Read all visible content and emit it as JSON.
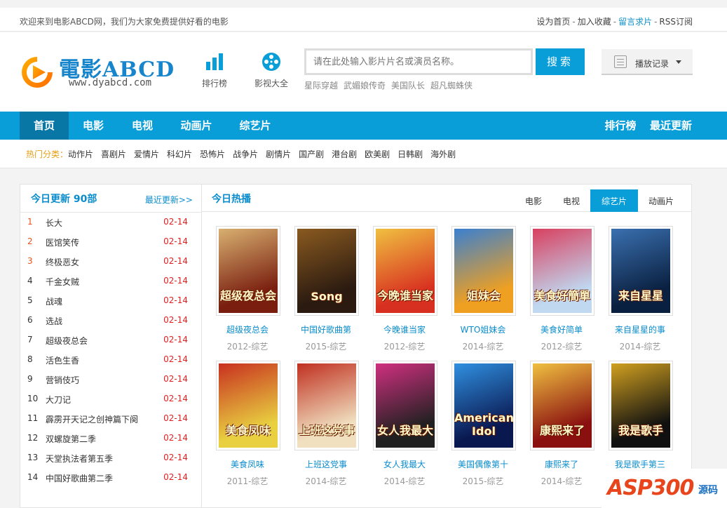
{
  "topbar": {
    "welcome": "欢迎来到电影ABCD网，我们为大家免费提供好看的电影",
    "links": [
      "设为首页",
      "加入收藏",
      "留言求片",
      "RSS订阅"
    ]
  },
  "logo": {
    "title": "電影ABCD",
    "domain": "www.dyabcd.com"
  },
  "header_icons": [
    {
      "label": "排行榜",
      "icon": "bar-chart-icon"
    },
    {
      "label": "影视大全",
      "icon": "film-reel-icon"
    }
  ],
  "search": {
    "placeholder": "请在此处输入影片片名或演员名称。",
    "button": "搜索",
    "hot_words": [
      "星际穿越",
      "武媚娘传奇",
      "美国队长",
      "超凡蜘蛛侠"
    ]
  },
  "history": {
    "label": "播放记录"
  },
  "nav": {
    "left": [
      "首页",
      "电影",
      "电视",
      "动画片",
      "综艺片"
    ],
    "right": [
      "排行榜",
      "最近更新"
    ]
  },
  "categories": {
    "label": "热门分类：",
    "items": [
      "动作片",
      "喜剧片",
      "爱情片",
      "科幻片",
      "恐怖片",
      "战争片",
      "剧情片",
      "国产剧",
      "港台剧",
      "欧美剧",
      "日韩剧",
      "海外剧"
    ]
  },
  "today_update": {
    "title": "今日更新 90部",
    "more": "最近更新>>",
    "items": [
      {
        "rank": "1",
        "name": "长大",
        "date": "02-14"
      },
      {
        "rank": "2",
        "name": "医馆笑传",
        "date": "02-14"
      },
      {
        "rank": "3",
        "name": "终极恶女",
        "date": "02-14"
      },
      {
        "rank": "4",
        "name": "千金女贼",
        "date": "02-14"
      },
      {
        "rank": "5",
        "name": "战魂",
        "date": "02-14"
      },
      {
        "rank": "6",
        "name": "选战",
        "date": "02-14"
      },
      {
        "rank": "7",
        "name": "超级夜总会",
        "date": "02-14"
      },
      {
        "rank": "8",
        "name": "活色生香",
        "date": "02-14"
      },
      {
        "rank": "9",
        "name": "营销伎巧",
        "date": "02-14"
      },
      {
        "rank": "10",
        "name": "大刀记",
        "date": "02-14"
      },
      {
        "rank": "11",
        "name": "霹雳开天记之创神篇下阕",
        "date": "02-14"
      },
      {
        "rank": "12",
        "name": "双螺旋第二季",
        "date": "02-14"
      },
      {
        "rank": "13",
        "name": "天堂执法者第五季",
        "date": "02-14"
      },
      {
        "rank": "14",
        "name": "中国好歌曲第二季",
        "date": "02-14"
      }
    ]
  },
  "hot_today": {
    "title": "今日热播",
    "tabs": [
      "电影",
      "电视",
      "综艺片",
      "动画片"
    ],
    "active_tab": "综艺片",
    "items": [
      {
        "title": "超级夜总会",
        "meta": "2012-综艺",
        "art": "超级夜总会",
        "bg": "#7a1f10",
        "bg2": "#d8b070"
      },
      {
        "title": "中国好歌曲第",
        "meta": "2015-综艺",
        "art": "Song",
        "bg": "#2a1a10",
        "bg2": "#8a5a20"
      },
      {
        "title": "今晚谁当家",
        "meta": "2012-综艺",
        "art": "今晚谁当家",
        "bg": "#d83020",
        "bg2": "#f0c040"
      },
      {
        "title": "WTO姐妹会",
        "meta": "2014-综艺",
        "art": "姐妹会",
        "bg": "#f0a020",
        "bg2": "#3a80d0"
      },
      {
        "title": "美食好简单",
        "meta": "2012-综艺",
        "art": "美食好簡單",
        "bg": "#c0d8f0",
        "bg2": "#d84060"
      },
      {
        "title": "来自星星的事",
        "meta": "2014-综艺",
        "art": "来自星星",
        "bg": "#0a2040",
        "bg2": "#3a70b0"
      },
      {
        "title": "美食凤味",
        "meta": "2011-综艺",
        "art": "美食凤味",
        "bg": "#e8d040",
        "bg2": "#c83020"
      },
      {
        "title": "上班这党事",
        "meta": "2014-综艺",
        "art": "上班这党事",
        "bg": "#f0e0c0",
        "bg2": "#c03020"
      },
      {
        "title": "女人我最大",
        "meta": "2014-综艺",
        "art": "女人我最大",
        "bg": "#202020",
        "bg2": "#d03080"
      },
      {
        "title": "美国偶像第十",
        "meta": "2015-综艺",
        "art": "American Idol",
        "bg": "#0a1850",
        "bg2": "#3090e0"
      },
      {
        "title": "康熙来了",
        "meta": "2014-综艺",
        "art": "康熙来了",
        "bg": "#8a1010",
        "bg2": "#f0c040"
      },
      {
        "title": "我是歌手第三",
        "meta": "2014-综艺",
        "art": "我是歌手",
        "bg": "#101010",
        "bg2": "#d0a020"
      }
    ]
  },
  "watermark": {
    "main": "ASP300",
    "sub": "源码"
  }
}
